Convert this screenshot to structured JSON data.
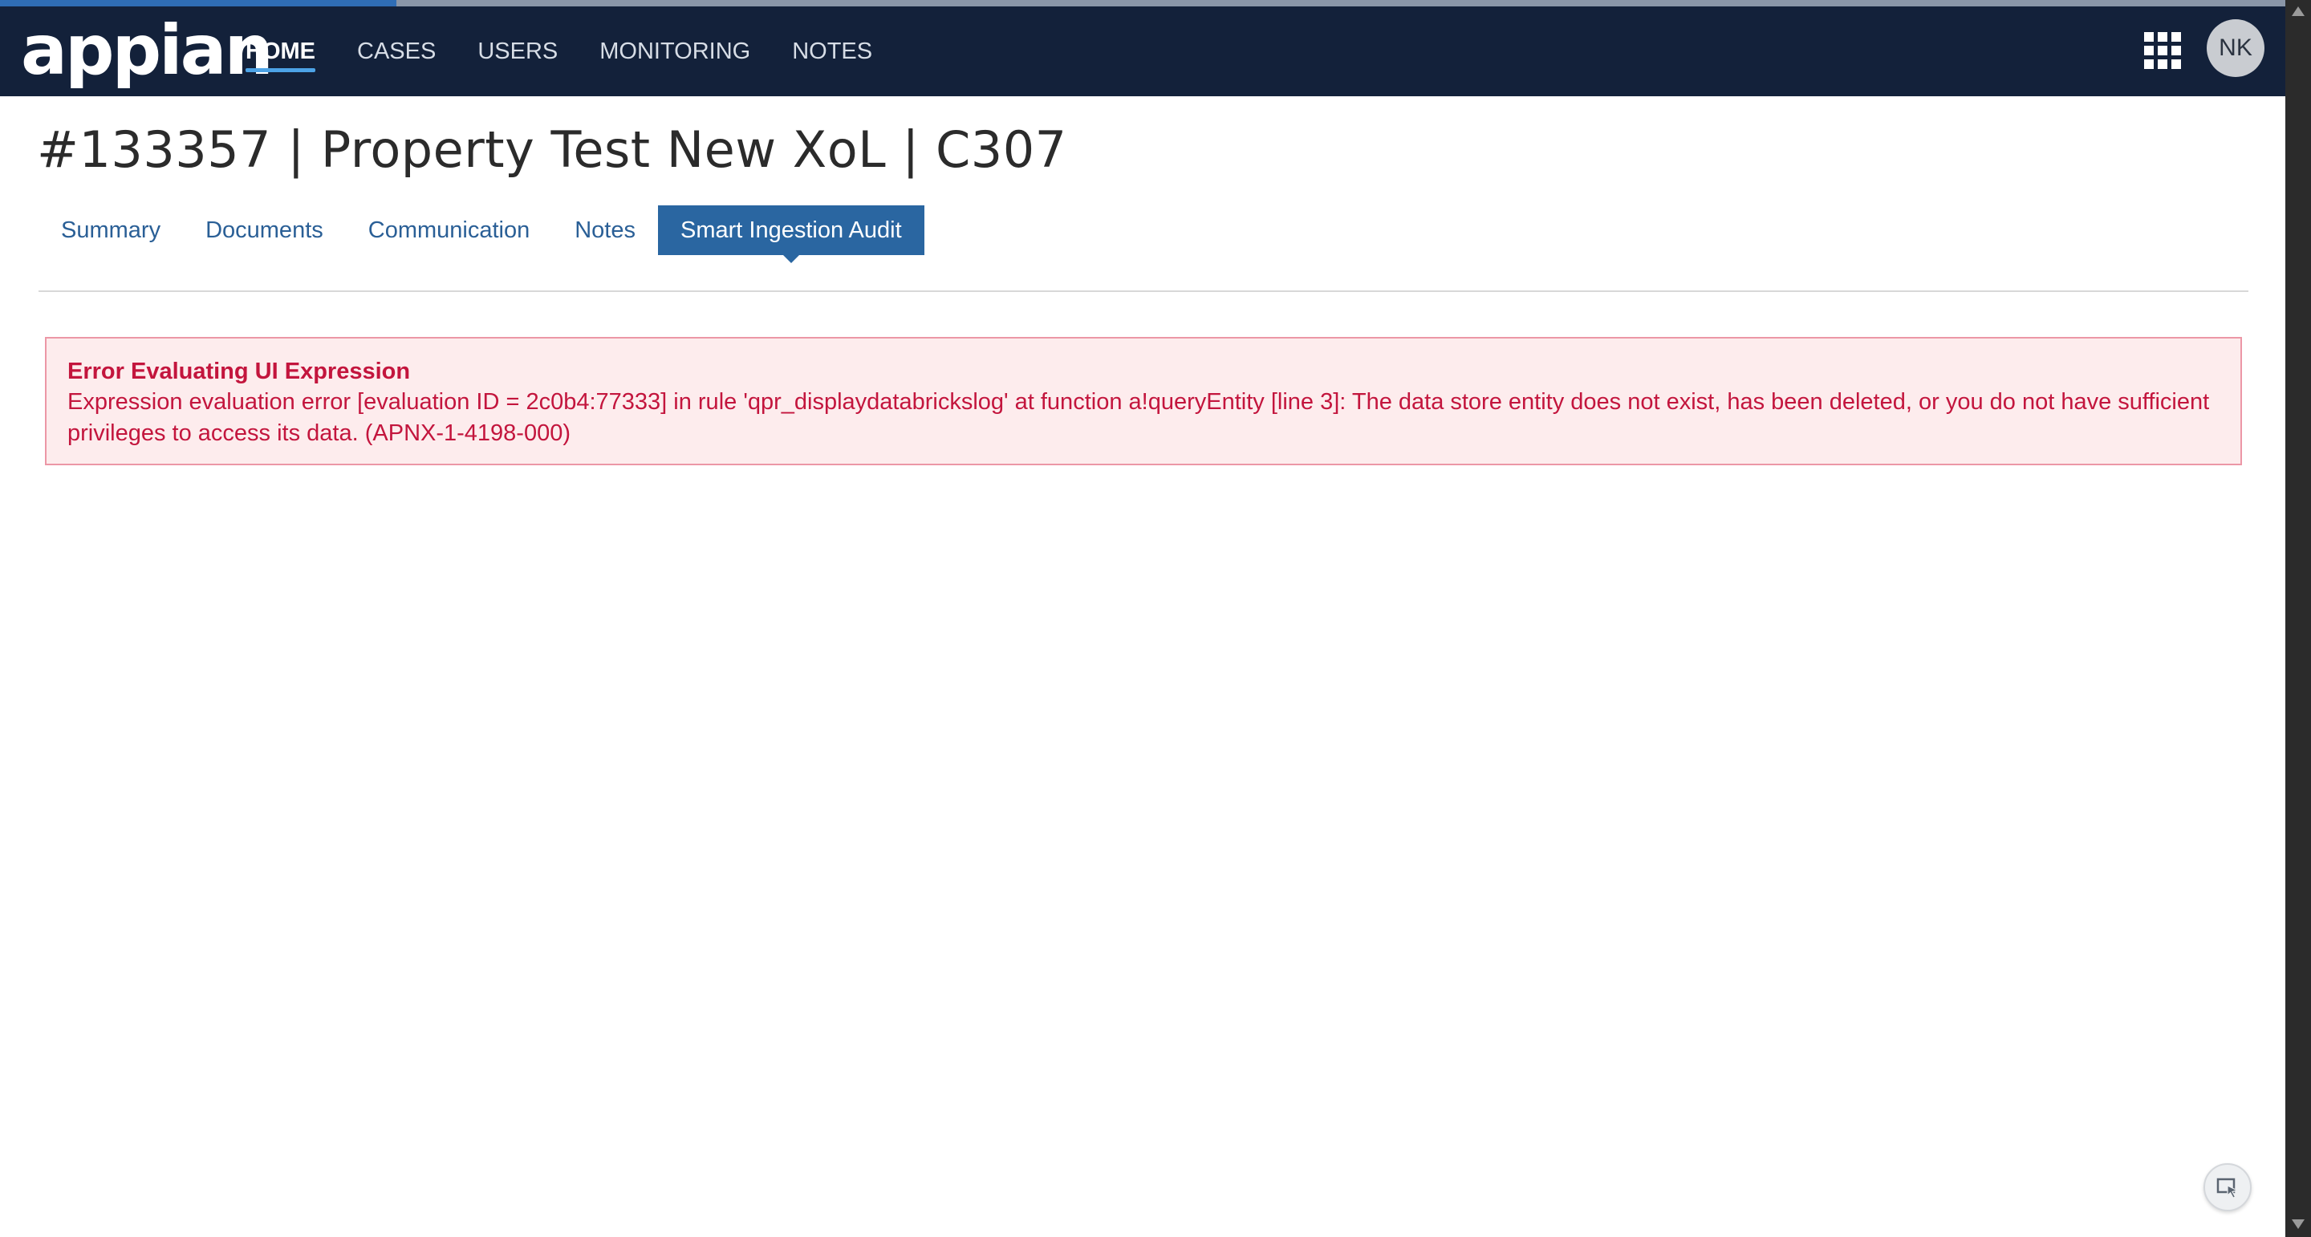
{
  "header": {
    "logo_text": "appian",
    "nav": [
      {
        "label": "HOME",
        "active": true
      },
      {
        "label": "CASES",
        "active": false
      },
      {
        "label": "USERS",
        "active": false
      },
      {
        "label": "MONITORING",
        "active": false
      },
      {
        "label": "NOTES",
        "active": false
      }
    ],
    "apps_icon": "grid-icon",
    "avatar_initials": "NK"
  },
  "page": {
    "title": "#133357 | Property Test New XoL | C307",
    "tabs": [
      {
        "label": "Summary",
        "active": false
      },
      {
        "label": "Documents",
        "active": false
      },
      {
        "label": "Communication",
        "active": false
      },
      {
        "label": "Notes",
        "active": false
      },
      {
        "label": "Smart Ingestion Audit",
        "active": true
      }
    ]
  },
  "error": {
    "title": "Error Evaluating UI Expression",
    "message": "Expression evaluation error [evaluation ID = 2c0b4:77333] in rule 'qpr_displaydatabrickslog' at function a!queryEntity [line 3]: The data store entity does not exist, has been deleted, or you do not have sufficient privileges to access its data. (APNX-1-4198-000)"
  },
  "floating_button_icon": "cursor-select-icon",
  "colors": {
    "header_bg": "#13213a",
    "accent": "#2a66a1",
    "error_text": "#c3153d",
    "error_bg": "#fdeced"
  }
}
